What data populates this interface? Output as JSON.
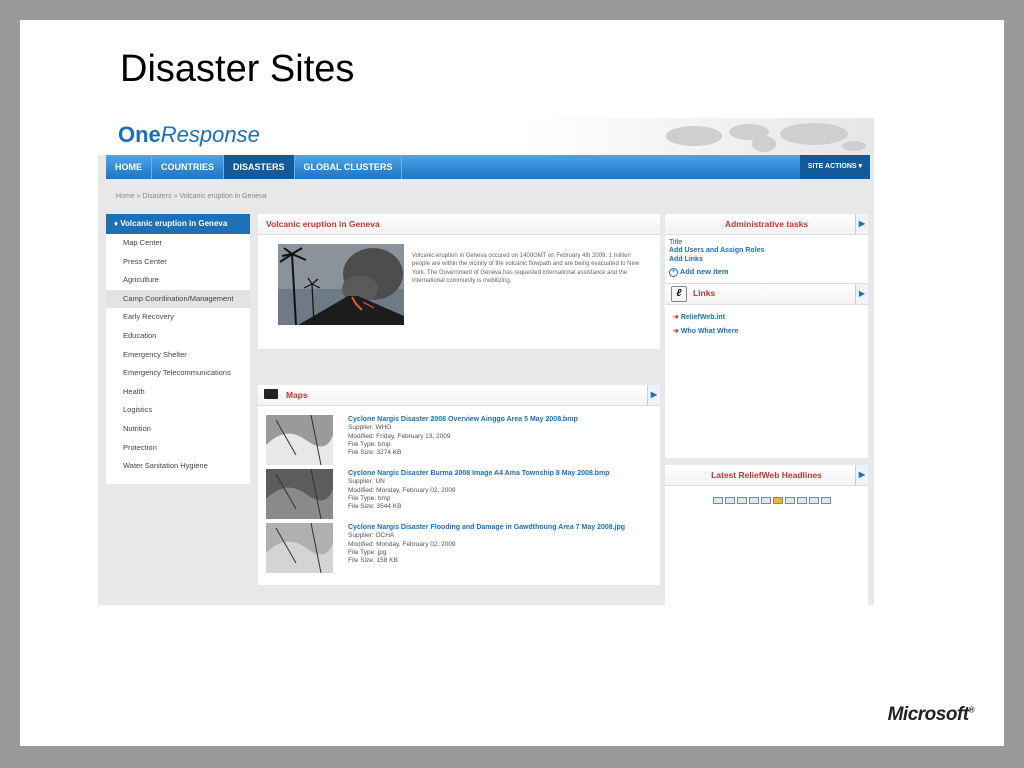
{
  "slide_title": "Disaster Sites",
  "footer_logo": "Microsoft",
  "site": {
    "logo_bold": "One",
    "logo_italic": "Response",
    "nav": [
      "HOME",
      "COUNTRIES",
      "DISASTERS",
      "GLOBAL CLUSTERS"
    ],
    "nav_active": "DISASTERS",
    "site_actions": "SITE ACTIONS ▾",
    "breadcrumb": "Home » Disasters » Volcanic eruption in Geneva",
    "left_nav": {
      "header": "♦ Volcanic eruption in Geneva",
      "items": [
        "Map Center",
        "Press Center",
        "Agriculture",
        "Camp Coordination/Management",
        "Early Recovery",
        "Education",
        "Emergency Shelter",
        "Emergency Telecommunications",
        "Health",
        "Logistics",
        "Nutrition",
        "Protection",
        "Water Sanitation Hygiene"
      ],
      "selected": "Camp Coordination/Management"
    },
    "volcano_panel": {
      "title": "Volcanic eruption in Geneva",
      "text": "Volcanic eruption in Geneva occured on 1400GMT on February 4th 2009. 1 million people are within the vicinity of the volcanic flowpath and are being evacuated to New York. The Government of Geneva has requested international assistance and the international community is mobilizing."
    },
    "maps_panel": {
      "title": "Maps",
      "items": [
        {
          "name": "Cyclone Nargis Disaster 2008 Overview Ainggo Area 5 May 2008.bmp",
          "supplier": "Supplier: WHO",
          "modified": "Modified: Friday, February 13, 2009",
          "type": "File Type: bmp",
          "size": "File Size: 3274 KB"
        },
        {
          "name": "Cyclone Nargis Disaster Burma 2008 Image A4 Ama Township 8 May 2008.bmp",
          "supplier": "Supplier: UN",
          "modified": "Modified: Monday, February 02, 2009",
          "type": "File Type: bmp",
          "size": "File Size: 3544 KB"
        },
        {
          "name": "Cyclone Nargis Disaster Flooding and Damage in Gawdthoung Area 7 May 2008.jpg",
          "supplier": "Supplier: OCHA",
          "modified": "Modified: Monday, February 02, 2009",
          "type": "File Type: jpg",
          "size": "File Size: 158 KB"
        }
      ]
    },
    "admin_panel": {
      "title": "Administrative tasks",
      "subtitle": "Title",
      "links": [
        "Add Users and Assign Roles",
        "Add Links"
      ],
      "add_item": "Add new item"
    },
    "links_panel": {
      "title": "Links",
      "items": [
        "ReliefWeb.int",
        "Who What Where"
      ]
    },
    "headlines_panel": {
      "title": "Latest ReliefWeb Headlines",
      "pages": 10,
      "active_page": 6
    },
    "colors": {
      "accent": "#1d6fb8",
      "heading_red": "#c0392b",
      "nav_dark": "#135a9a"
    }
  }
}
